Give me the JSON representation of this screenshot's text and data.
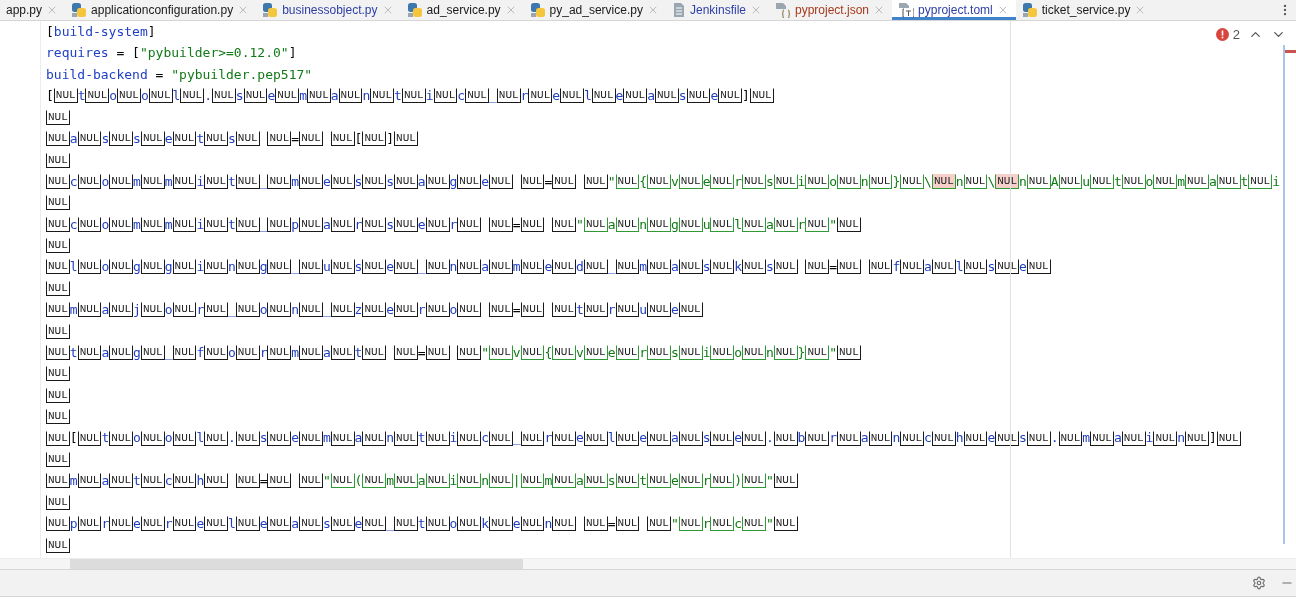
{
  "tabs": [
    {
      "label": "app.py",
      "kind": "none",
      "color": "#1a1a1a",
      "selected": false
    },
    {
      "label": "applicationconfiguration.py",
      "kind": "python",
      "color": "#1a1a1a",
      "selected": false
    },
    {
      "label": "businessobject.py",
      "kind": "python",
      "color": "#2d3fa8",
      "selected": false
    },
    {
      "label": "ad_service.py",
      "kind": "python",
      "color": "#1a1a1a",
      "selected": false
    },
    {
      "label": "py_ad_service.py",
      "kind": "python",
      "color": "#1a1a1a",
      "selected": false
    },
    {
      "label": "Jenkinsfile",
      "kind": "text",
      "color": "#2d3fa8",
      "selected": false
    },
    {
      "label": "pyproject.json",
      "kind": "json",
      "color": "#a8391c",
      "selected": false
    },
    {
      "label": "pyproject.toml",
      "kind": "toml",
      "color": "#2d3fa8",
      "selected": true
    },
    {
      "label": "ticket_service.py",
      "kind": "python",
      "color": "#1a1a1a",
      "selected": false
    }
  ],
  "inspection": {
    "count": "2"
  },
  "lines": [
    {
      "kind": "plain",
      "runs": [
        {
          "kind": "plain",
          "tokens": [
            "["
          ]
        },
        {
          "kind": "key",
          "tokens": [
            "build-system"
          ]
        },
        {
          "kind": "plain",
          "tokens": [
            "]"
          ]
        }
      ]
    },
    {
      "kind": "plain",
      "runs": [
        {
          "kind": "key",
          "tokens": [
            "requires"
          ]
        },
        {
          "kind": "plain",
          "tokens": [
            " = ["
          ]
        },
        {
          "kind": "string",
          "tokens": [
            "\"pybuilder>=0.12.0\""
          ]
        },
        {
          "kind": "plain",
          "tokens": [
            "]"
          ]
        }
      ]
    },
    {
      "kind": "plain",
      "runs": [
        {
          "kind": "key",
          "tokens": [
            "build-backend"
          ]
        },
        {
          "kind": "plain",
          "tokens": [
            " = "
          ]
        },
        {
          "kind": "string",
          "tokens": [
            "\"pybuilder.pep517\""
          ]
        }
      ]
    },
    {
      "kind": "char-first",
      "runs": [
        {
          "kind": "plain",
          "tokens": [
            "[",
            "NUL"
          ]
        },
        {
          "kind": "key",
          "tokens": [
            "t",
            "NUL",
            "o",
            "NUL",
            "o",
            "NUL",
            "l",
            "NUL",
            ".",
            "NUL",
            "s",
            "NUL",
            "e",
            "NUL",
            "m",
            "NUL",
            "a",
            "NUL",
            "n",
            "NUL",
            "t",
            "NUL",
            "i",
            "NUL",
            "c",
            "NUL",
            "_",
            "NUL",
            "r",
            "NUL",
            "e",
            "NUL",
            "l",
            "NUL",
            "e",
            "NUL",
            "a",
            "NUL",
            "s",
            "NUL",
            "e",
            "NUL"
          ]
        },
        {
          "kind": "plain",
          "tokens": [
            "]",
            "NUL"
          ]
        }
      ]
    },
    {
      "kind": "box-first",
      "runs": [
        {
          "kind": "plain",
          "tokens": [
            "NUL"
          ]
        }
      ]
    },
    {
      "kind": "box-first",
      "runs": [
        {
          "kind": "key",
          "tokens": [
            "NUL",
            "a",
            "NUL",
            "s",
            "NUL",
            "s",
            "NUL",
            "e",
            "NUL",
            "t",
            "NUL",
            "s"
          ]
        },
        {
          "kind": "plain",
          "tokens": [
            "NUL NUL",
            "=",
            "NUL NUL",
            "[",
            "NUL",
            "]",
            "NUL"
          ]
        }
      ]
    },
    {
      "kind": "box-first",
      "runs": [
        {
          "kind": "plain",
          "tokens": [
            "NUL"
          ]
        }
      ]
    },
    {
      "kind": "box-first",
      "runs": [
        {
          "kind": "key",
          "tokens": [
            "NUL",
            "c",
            "NUL",
            "o",
            "NUL",
            "m",
            "NUL",
            "m",
            "NUL",
            "i",
            "NUL",
            "t",
            "NUL",
            "_",
            "NUL",
            "m",
            "NUL",
            "e",
            "NUL",
            "s",
            "NUL",
            "s",
            "NUL",
            "a",
            "NUL",
            "g",
            "NUL",
            "e"
          ]
        },
        {
          "kind": "plain",
          "tokens": [
            "NUL NUL",
            "=",
            "NUL NUL"
          ]
        },
        {
          "kind": "string",
          "tokens": [
            "\"",
            "NUL",
            "{",
            "NUL",
            "v",
            "NUL",
            "e",
            "NUL",
            "r",
            "NUL",
            "s",
            "NUL",
            "i",
            "NUL",
            "o",
            "NUL",
            "n",
            "NUL",
            "}",
            "NUL",
            "\\"
          ]
        },
        {
          "kind": "escape",
          "tokens": [
            "NUL"
          ]
        },
        {
          "kind": "string",
          "tokens": [
            "n",
            "NUL",
            "\\"
          ]
        },
        {
          "kind": "escape",
          "tokens": [
            "NUL"
          ]
        },
        {
          "kind": "string",
          "tokens": [
            "n",
            "NUL",
            "A",
            "NUL",
            "u",
            "NUL",
            "t",
            "NUL",
            "o",
            "NUL",
            "m",
            "NUL",
            "a",
            "NUL",
            "t",
            "NUL",
            "i"
          ]
        }
      ]
    },
    {
      "kind": "box-first",
      "runs": [
        {
          "kind": "plain",
          "tokens": [
            "NUL"
          ]
        }
      ]
    },
    {
      "kind": "box-first",
      "runs": [
        {
          "kind": "key",
          "tokens": [
            "NUL",
            "c",
            "NUL",
            "o",
            "NUL",
            "m",
            "NUL",
            "m",
            "NUL",
            "i",
            "NUL",
            "t",
            "NUL",
            "_",
            "NUL",
            "p",
            "NUL",
            "a",
            "NUL",
            "r",
            "NUL",
            "s",
            "NUL",
            "e",
            "NUL",
            "r"
          ]
        },
        {
          "kind": "plain",
          "tokens": [
            "NUL NUL",
            "=",
            "NUL NUL"
          ]
        },
        {
          "kind": "string",
          "tokens": [
            "\"",
            "NUL",
            "a",
            "NUL",
            "n",
            "NUL",
            "g",
            "NUL",
            "u",
            "NUL",
            "l",
            "NUL",
            "a",
            "NUL",
            "r",
            "NUL",
            "\""
          ]
        },
        {
          "kind": "plain",
          "tokens": [
            "NUL"
          ]
        }
      ]
    },
    {
      "kind": "box-first",
      "runs": [
        {
          "kind": "plain",
          "tokens": [
            "NUL"
          ]
        }
      ]
    },
    {
      "kind": "box-first",
      "runs": [
        {
          "kind": "key",
          "tokens": [
            "NUL",
            "l",
            "NUL",
            "o",
            "NUL",
            "g",
            "NUL",
            "g",
            "NUL",
            "i",
            "NUL",
            "n",
            "NUL",
            "g",
            "NUL",
            "_",
            "NUL",
            "u",
            "NUL",
            "s",
            "NUL",
            "e",
            "NUL",
            "_",
            "NUL",
            "n",
            "NUL",
            "a",
            "NUL",
            "m",
            "NUL",
            "e",
            "NUL",
            "d",
            "NUL",
            "_",
            "NUL",
            "m",
            "NUL",
            "a",
            "NUL",
            "s",
            "NUL",
            "k",
            "NUL",
            "s"
          ]
        },
        {
          "kind": "plain",
          "tokens": [
            "NUL NUL",
            "=",
            "NUL NUL"
          ]
        },
        {
          "kind": "key",
          "tokens": [
            "f",
            "NUL",
            "a",
            "NUL",
            "l",
            "NUL",
            "s",
            "NUL",
            "e"
          ]
        },
        {
          "kind": "plain",
          "tokens": [
            "NUL"
          ]
        }
      ]
    },
    {
      "kind": "box-first",
      "runs": [
        {
          "kind": "plain",
          "tokens": [
            "NUL"
          ]
        }
      ]
    },
    {
      "kind": "box-first",
      "runs": [
        {
          "kind": "key",
          "tokens": [
            "NUL",
            "m",
            "NUL",
            "a",
            "NUL",
            "j",
            "NUL",
            "o",
            "NUL",
            "r",
            "NUL",
            "_",
            "NUL",
            "o",
            "NUL",
            "n",
            "NUL",
            "_",
            "NUL",
            "z",
            "NUL",
            "e",
            "NUL",
            "r",
            "NUL",
            "o"
          ]
        },
        {
          "kind": "plain",
          "tokens": [
            "NUL NUL",
            "=",
            "NUL NUL"
          ]
        },
        {
          "kind": "key",
          "tokens": [
            "t",
            "NUL",
            "r",
            "NUL",
            "u",
            "NUL",
            "e"
          ]
        },
        {
          "kind": "plain",
          "tokens": [
            "NUL"
          ]
        }
      ]
    },
    {
      "kind": "box-first",
      "runs": [
        {
          "kind": "plain",
          "tokens": [
            "NUL"
          ]
        }
      ]
    },
    {
      "kind": "box-first",
      "runs": [
        {
          "kind": "key",
          "tokens": [
            "NUL",
            "t",
            "NUL",
            "a",
            "NUL",
            "g",
            "NUL",
            "_",
            "NUL",
            "f",
            "NUL",
            "o",
            "NUL",
            "r",
            "NUL",
            "m",
            "NUL",
            "a",
            "NUL",
            "t"
          ]
        },
        {
          "kind": "plain",
          "tokens": [
            "NUL NUL",
            "=",
            "NUL NUL"
          ]
        },
        {
          "kind": "string",
          "tokens": [
            "\"",
            "NUL",
            "v",
            "NUL",
            "{",
            "NUL",
            "v",
            "NUL",
            "e",
            "NUL",
            "r",
            "NUL",
            "s",
            "NUL",
            "i",
            "NUL",
            "o",
            "NUL",
            "n",
            "NUL",
            "}",
            "NUL",
            "\""
          ]
        },
        {
          "kind": "plain",
          "tokens": [
            "NUL"
          ]
        }
      ]
    },
    {
      "kind": "box-first",
      "runs": [
        {
          "kind": "plain",
          "tokens": [
            "NUL"
          ]
        }
      ]
    },
    {
      "kind": "box-first",
      "runs": [
        {
          "kind": "plain",
          "tokens": [
            "NUL"
          ]
        }
      ]
    },
    {
      "kind": "box-first",
      "runs": [
        {
          "kind": "plain",
          "tokens": [
            "NUL"
          ]
        }
      ]
    },
    {
      "kind": "box-first",
      "runs": [
        {
          "kind": "plain",
          "tokens": [
            "NUL",
            "["
          ]
        },
        {
          "kind": "key",
          "tokens": [
            "NUL",
            "t",
            "NUL",
            "o",
            "NUL",
            "o",
            "NUL",
            "l",
            "NUL",
            ".",
            "NUL",
            "s",
            "NUL",
            "e",
            "NUL",
            "m",
            "NUL",
            "a",
            "NUL",
            "n",
            "NUL",
            "t",
            "NUL",
            "i",
            "NUL",
            "c",
            "NUL",
            "_",
            "NUL",
            "r",
            "NUL",
            "e",
            "NUL",
            "l",
            "NUL",
            "e",
            "NUL",
            "a",
            "NUL",
            "s",
            "NUL",
            "e",
            "NUL",
            ".",
            "NUL",
            "b",
            "NUL",
            "r",
            "NUL",
            "a",
            "NUL",
            "n",
            "NUL",
            "c",
            "NUL",
            "h",
            "NUL",
            "e",
            "NUL",
            "s",
            "NUL",
            ".",
            "NUL",
            "m",
            "NUL",
            "a",
            "NUL",
            "i",
            "NUL",
            "n"
          ]
        },
        {
          "kind": "plain",
          "tokens": [
            "NUL",
            "]",
            "NUL"
          ]
        }
      ]
    },
    {
      "kind": "box-first",
      "runs": [
        {
          "kind": "plain",
          "tokens": [
            "NUL"
          ]
        }
      ]
    },
    {
      "kind": "box-first",
      "runs": [
        {
          "kind": "key",
          "tokens": [
            "NUL",
            "m",
            "NUL",
            "a",
            "NUL",
            "t",
            "NUL",
            "c",
            "NUL",
            "h"
          ]
        },
        {
          "kind": "plain",
          "tokens": [
            "NUL NUL",
            "=",
            "NUL NUL"
          ]
        },
        {
          "kind": "string",
          "tokens": [
            "\"",
            "NUL",
            "(",
            "NUL",
            "m",
            "NUL",
            "a",
            "NUL",
            "i",
            "NUL",
            "n",
            "NUL",
            "|",
            "NUL",
            "m",
            "NUL",
            "a",
            "NUL",
            "s",
            "NUL",
            "t",
            "NUL",
            "e",
            "NUL",
            "r",
            "NUL",
            ")",
            "NUL",
            "\""
          ]
        },
        {
          "kind": "plain",
          "tokens": [
            "NUL"
          ]
        }
      ]
    },
    {
      "kind": "box-first",
      "runs": [
        {
          "kind": "plain",
          "tokens": [
            "NUL"
          ]
        }
      ]
    },
    {
      "kind": "box-first",
      "runs": [
        {
          "kind": "key",
          "tokens": [
            "NUL",
            "p",
            "NUL",
            "r",
            "NUL",
            "e",
            "NUL",
            "r",
            "NUL",
            "e",
            "NUL",
            "l",
            "NUL",
            "e",
            "NUL",
            "a",
            "NUL",
            "s",
            "NUL",
            "e",
            "NUL",
            "_",
            "NUL",
            "t",
            "NUL",
            "o",
            "NUL",
            "k",
            "NUL",
            "e",
            "NUL",
            "n"
          ]
        },
        {
          "kind": "plain",
          "tokens": [
            "NUL NUL",
            "=",
            "NUL NUL"
          ]
        },
        {
          "kind": "string",
          "tokens": [
            "\"",
            "NUL",
            "r",
            "NUL",
            "c",
            "NUL",
            "\""
          ]
        },
        {
          "kind": "plain",
          "tokens": [
            "NUL"
          ]
        }
      ]
    },
    {
      "kind": "box-first",
      "runs": [
        {
          "kind": "plain",
          "tokens": [
            "NUL"
          ]
        }
      ]
    }
  ]
}
